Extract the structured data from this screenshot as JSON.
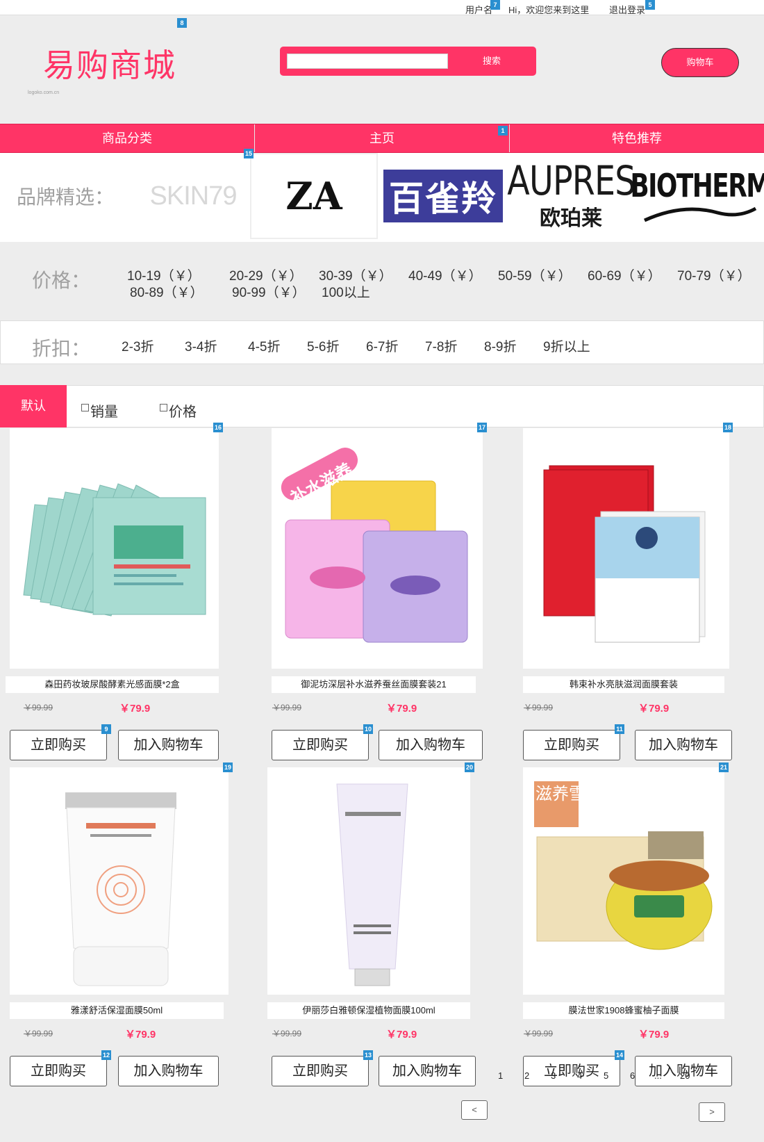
{
  "topbar": {
    "username": "用户名",
    "greeting": "Hi，欢迎您来到这里",
    "logout": "退出登录"
  },
  "header": {
    "logo": "易购商城",
    "logo_sub": "logoko.com.cn",
    "search_placeholder": "",
    "search_button": "搜索",
    "cart_button": "购物车"
  },
  "nav": {
    "items": [
      "商品分类",
      "主页",
      "特色推荐"
    ]
  },
  "brands": {
    "label": "品牌精选：",
    "items": [
      {
        "name": "SKIN79"
      },
      {
        "name": "ZA"
      },
      {
        "name": "百雀羚"
      },
      {
        "name": "AUPRES",
        "sub": "欧珀莱"
      },
      {
        "name": "BIOTHERM"
      }
    ]
  },
  "price_filter": {
    "label": "价格：",
    "options": [
      "10-19（￥）",
      "20-29（￥）",
      "30-39（￥）",
      "40-49（￥）",
      "50-59（￥）",
      "60-69（￥）",
      "70-79（￥）",
      "80-89（￥）",
      "90-99（￥）",
      "100以上"
    ]
  },
  "discount_filter": {
    "label": "折扣：",
    "options": [
      "2-3折",
      "3-4折",
      "4-5折",
      "5-6折",
      "6-7折",
      "7-8折",
      "8-9折",
      "9折以上"
    ]
  },
  "sort": {
    "default": "默认",
    "sales": "销量",
    "price": "价格"
  },
  "products": [
    {
      "name": "森田药妆玻尿酸酵素光感面膜*2盒",
      "old_price": "￥99.99",
      "new_price": "￥79.9",
      "buy": "立即购买",
      "add_cart": "加入购物车"
    },
    {
      "name": "御泥坊深层补水滋养蚕丝面膜套装21",
      "old_price": "￥99.99",
      "new_price": "￥79.9",
      "buy": "立即购买",
      "add_cart": "加入购物车",
      "tag": "补水滋养"
    },
    {
      "name": "韩束补水亮肤滋润面膜套装",
      "old_price": "￥99.99",
      "new_price": "￥79.9",
      "buy": "立即购买",
      "add_cart": "加入购物车"
    },
    {
      "name": "雅漾舒活保湿面膜50ml",
      "old_price": "￥99.99",
      "new_price": "￥79.9",
      "buy": "立即购买",
      "add_cart": "加入购物车"
    },
    {
      "name": "伊丽莎白雅顿保湿植物面膜100ml",
      "old_price": "￥99.99",
      "new_price": "￥79.9",
      "buy": "立即购买",
      "add_cart": "加入购物车"
    },
    {
      "name": "膜法世家1908蜂蜜柚子面膜",
      "old_price": "￥99.99",
      "new_price": "￥79.9",
      "buy": "立即购买",
      "add_cart": "加入购物车",
      "tag": "滋养雪肌"
    }
  ],
  "pager": {
    "prev": "<",
    "next": ">",
    "pages": [
      "1",
      "2",
      "3",
      "4",
      "5",
      "6",
      "...",
      "20"
    ]
  },
  "badges": [
    "7",
    "5",
    "8",
    "1",
    "15",
    "16",
    "17",
    "18",
    "9",
    "10",
    "11",
    "19",
    "20",
    "21",
    "12",
    "13",
    "14"
  ],
  "colors": {
    "accent": "#ff3466",
    "badge": "#2a8fd0"
  }
}
